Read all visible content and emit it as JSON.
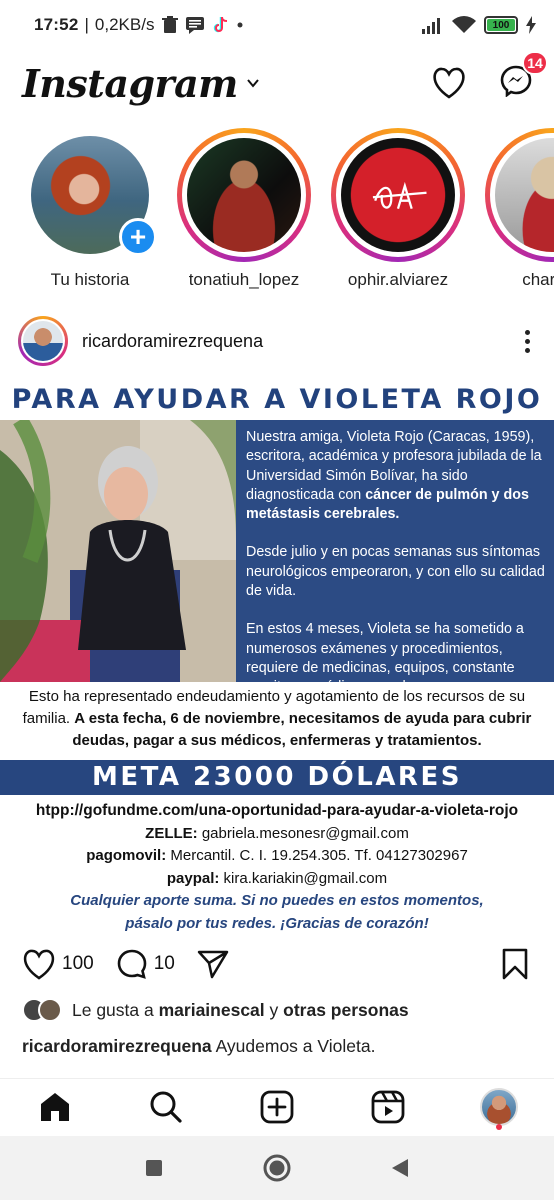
{
  "status_bar": {
    "time": "17:52",
    "network_speed": "0,2KB/s",
    "battery": "100",
    "icons": [
      "trash-icon",
      "chat-icon",
      "tiktok-icon",
      "dot-icon",
      "signal-icon",
      "wifi-icon",
      "battery-icon",
      "charging-icon"
    ]
  },
  "header": {
    "logo": "Instagram",
    "notifications_badge": "14"
  },
  "stories": [
    {
      "name": "Tu historia",
      "own": true
    },
    {
      "name": "tonatiuh_lopez",
      "own": false
    },
    {
      "name": "ophir.alviarez",
      "own": false
    },
    {
      "name": "charlieа",
      "own": false
    }
  ],
  "post": {
    "username": "ricardoramirezrequena",
    "flyer": {
      "title": "PARA AYUDAR A VIOLETA ROJO",
      "box_p1_a": "Nuestra amiga, Violeta Rojo (Caracas, 1959), escritora, académica y profesora jubilada de la Universidad Simón Bolívar, ha sido diagnosticada con ",
      "box_p1_b": "cáncer de pulmón y dos metástasis cerebrales.",
      "box_p2": "Desde julio y en pocas semanas sus síntomas neurológicos empeoraron, y con ello su calidad de vida.",
      "box_p3": "En estos 4 meses, Violeta se ha sometido a numerosos exámenes y procedimientos, requiere de medicinas, equipos, constante monitoreo médico y ayuda.",
      "para_a": "Esto ha representado endeudamiento y agotamiento de los recursos de su familia. ",
      "para_b": "A esta fecha, 6 de noviembre, necesitamos de ayuda para cubrir deudas, pagar a sus médicos, enfermeras y tratamientos.",
      "goal": "META 23000 DÓLARES",
      "url": "htpp://gofundme.com/una-oportunidad-para-ayudar-a-violeta-rojo",
      "zelle_label": "ZELLE:",
      "zelle_value": " gabriela.mesonesr@gmail.com",
      "pagomovil_label": "pagomovil:",
      "pagomovil_value": " Mercantil. C. I. 19.254.305. Tf. 04127302967",
      "paypal_label": "paypal:",
      "paypal_value": " kira.kariakin@gmail.com",
      "closing_1": "Cualquier aporte suma. Si no puedes en estos momentos,",
      "closing_2": "pásalo por tus redes. ¡Gracias de corazón!"
    },
    "likes_count": "100",
    "comments_count": "10",
    "liked_by_prefix": "Le gusta a ",
    "liked_by_user": "mariainescal",
    "liked_by_mid": " y ",
    "liked_by_rest": "otras personas",
    "caption_user": "ricardoramirezrequena",
    "caption_text": " Ayudemos a Violeta."
  },
  "colors": {
    "flyer_blue": "#2c4b84",
    "title_blue": "#22427d",
    "badge_red": "#ed2e48",
    "add_blue": "#1a8cf0"
  }
}
